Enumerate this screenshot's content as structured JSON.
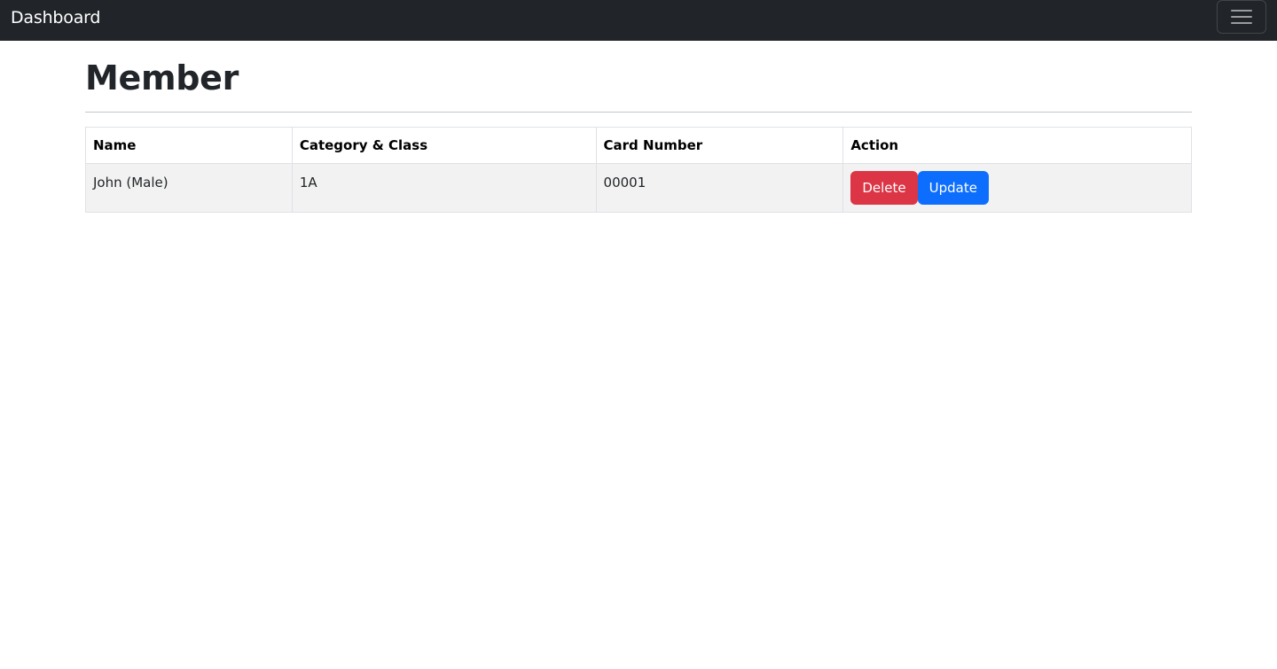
{
  "navbar": {
    "brand": "Dashboard",
    "toggler_icon": "hamburger-menu-icon"
  },
  "page": {
    "title": "Member"
  },
  "table": {
    "columns": [
      "Name",
      "Category & Class",
      "Card Number",
      "Action"
    ],
    "rows": [
      {
        "name": "John (Male)",
        "category_class": "1A",
        "card_number": "00001",
        "actions": {
          "delete_label": "Delete",
          "update_label": "Update"
        }
      }
    ]
  },
  "colors": {
    "navbar_bg": "#212529",
    "delete_button": "#dc3545",
    "update_button": "#0d6efd",
    "row_bg": "#f2f2f2"
  }
}
